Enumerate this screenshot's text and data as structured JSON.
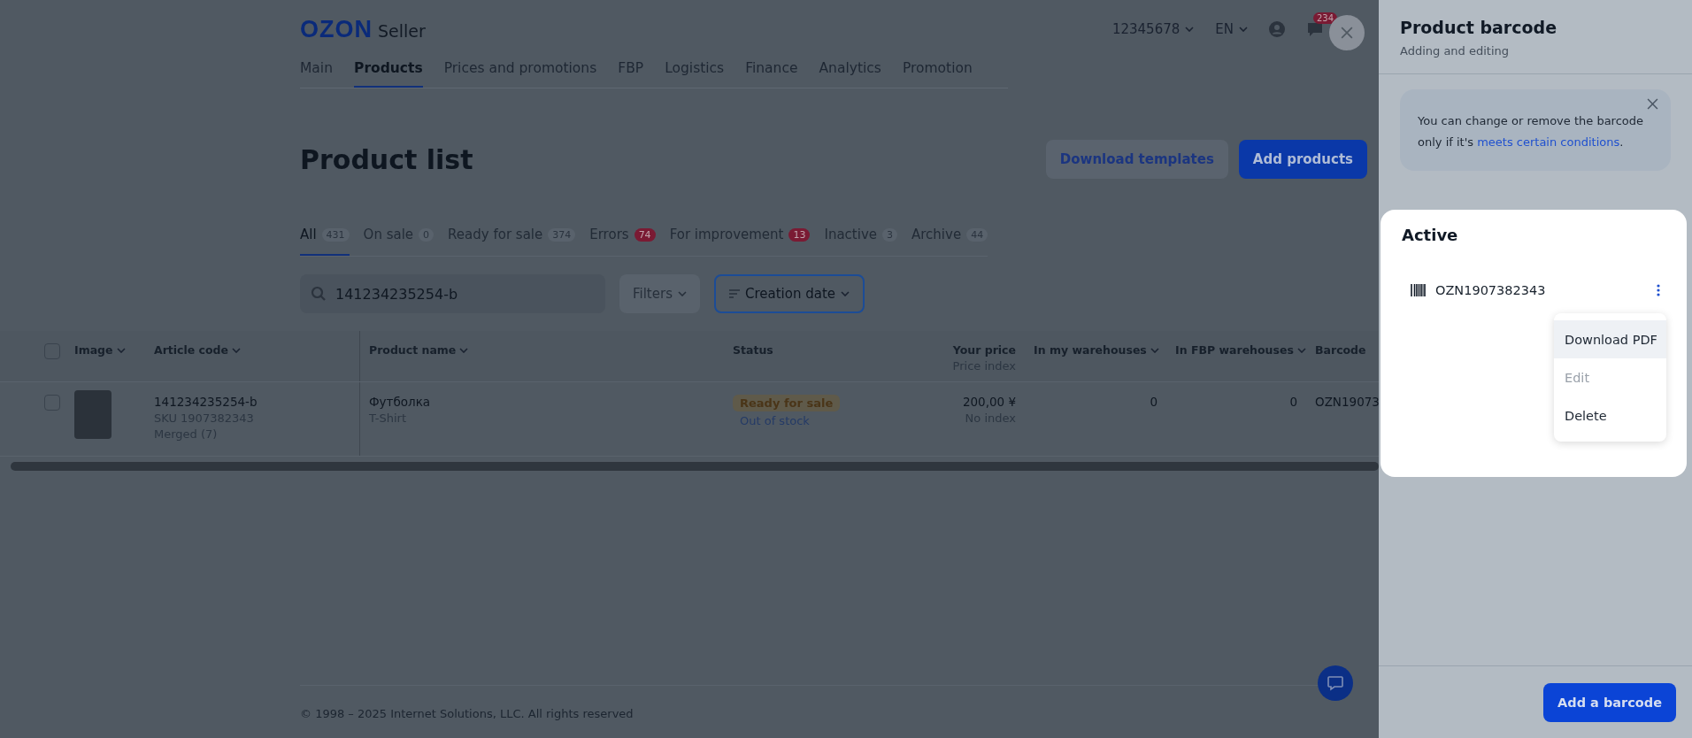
{
  "header": {
    "logo": "OZON",
    "logo_suffix": "Seller",
    "account": "12345678",
    "language": "EN",
    "chat_badge": "234"
  },
  "nav": [
    {
      "label": "Main",
      "selected": false
    },
    {
      "label": "Products",
      "selected": true
    },
    {
      "label": "Prices and promotions",
      "selected": false
    },
    {
      "label": "FBP",
      "selected": false
    },
    {
      "label": "Logistics",
      "selected": false
    },
    {
      "label": "Finance",
      "selected": false
    },
    {
      "label": "Analytics",
      "selected": false
    },
    {
      "label": "Promotion",
      "selected": false
    }
  ],
  "page_title": "Product list",
  "actions": [
    "Download templates",
    "Add products"
  ],
  "tabs": [
    {
      "label": "All",
      "count": "431",
      "alert": false,
      "selected": true
    },
    {
      "label": "On sale",
      "count": "0",
      "alert": false,
      "selected": false
    },
    {
      "label": "Ready for sale",
      "count": "374",
      "alert": false,
      "selected": false
    },
    {
      "label": "Errors",
      "count": "74",
      "alert": true,
      "selected": false
    },
    {
      "label": "For improvement",
      "count": "13",
      "alert": true,
      "selected": false
    },
    {
      "label": "Inactive",
      "count": "3",
      "alert": false,
      "selected": false
    },
    {
      "label": "Archive",
      "count": "44",
      "alert": false,
      "selected": false
    }
  ],
  "search": {
    "value": "141234235254-b"
  },
  "filters": "Filters",
  "sort": "Creation date",
  "table": {
    "select_all_checked": false,
    "columns": [
      {
        "label": "Image",
        "sortable": true
      },
      {
        "label": "Article code",
        "sortable": true
      },
      {
        "label": "Product name",
        "sortable": true
      },
      {
        "label": "Status",
        "sortable": false
      },
      {
        "label": "Your price",
        "sub": "Price index",
        "sortable": false
      },
      {
        "label": "In my warehouses",
        "sortable": true
      },
      {
        "label": "In FBP warehouses",
        "sortable": true
      },
      {
        "label": "Barcode",
        "sortable": false
      }
    ],
    "rows": [
      {
        "checked": false,
        "article": "141234235254-b",
        "sku": "SKU 1907382343",
        "merged": "Merged (7)",
        "name": "Футболка",
        "name_sub": "T-Shirt",
        "status": "Ready for sale",
        "status_sub": "Out of stock",
        "price": "200,00 ¥",
        "price_sub": "No index",
        "my_warehouses": "0",
        "fbp_warehouses": "0",
        "barcode": "OZN19073"
      }
    ]
  },
  "footer": "© 1998 – 2025 Internet Solutions, LLC. All rights reserved",
  "panel": {
    "title": "Product barcode",
    "subtitle": "Adding and editing",
    "notice": "You can change or remove the barcode only if it's ",
    "notice_link": "meets certain conditions",
    "notice_end": ".",
    "section": "Active",
    "barcode": "OZN1907382343",
    "menu": [
      {
        "label": "Download PDF",
        "hovered": true,
        "disabled": false
      },
      {
        "label": "Edit",
        "hovered": false,
        "disabled": true
      },
      {
        "label": "Delete",
        "hovered": false,
        "disabled": false
      }
    ],
    "button": "Add a barcode"
  }
}
